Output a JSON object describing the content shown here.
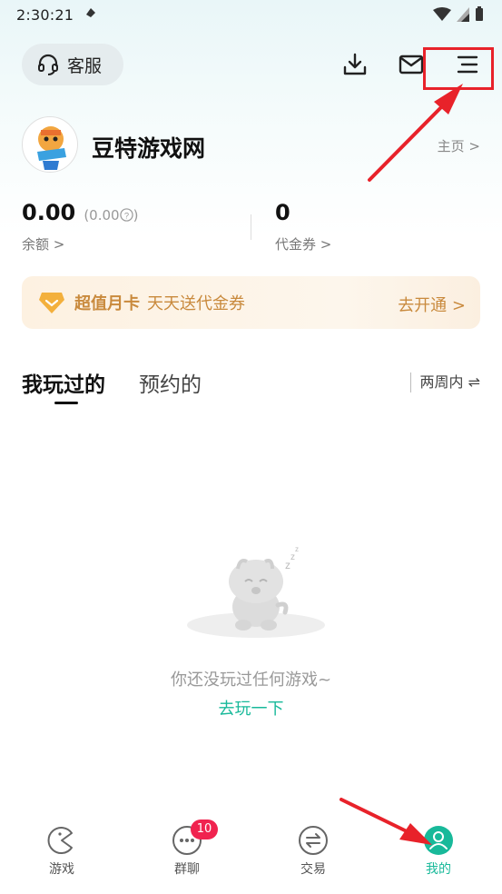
{
  "status_bar": {
    "time": "2:30:21"
  },
  "header": {
    "service_label": "客服"
  },
  "profile": {
    "name": "豆特游戏网",
    "homepage_link": "主页 >"
  },
  "wallet": {
    "balance_value": "0.00",
    "balance_sub": "(0.00",
    "balance_sub_close": ")",
    "balance_label": "余额 >",
    "coupon_value": "0",
    "coupon_label": "代金券 >"
  },
  "vip_card": {
    "title": "超值月卡",
    "subtitle": "天天送代金券",
    "action": "去开通 >"
  },
  "tabs": {
    "played": "我玩过的",
    "reserved": "预约的",
    "filter": "两周内 ⇌"
  },
  "empty_state": {
    "message": "你还没玩过任何游戏~",
    "action": "去玩一下"
  },
  "bottom_nav": {
    "items": [
      {
        "label": "游戏",
        "icon": "pacman-icon"
      },
      {
        "label": "群聊",
        "icon": "chat-icon",
        "badge": "10"
      },
      {
        "label": "交易",
        "icon": "swap-icon"
      },
      {
        "label": "我的",
        "icon": "user-icon",
        "active": true
      }
    ]
  },
  "colors": {
    "accent": "#18b99a",
    "annotation": "#e8222a",
    "vip": "#c98a3d",
    "badge": "#f0234f"
  }
}
